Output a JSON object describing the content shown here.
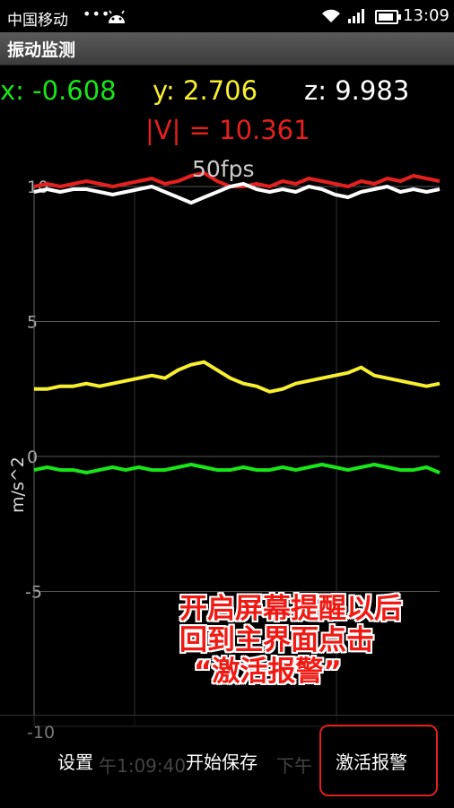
{
  "status_bar": {
    "carrier": "中国移动",
    "dots": "•••",
    "time": "13:09",
    "icons": [
      "android-icon",
      "wifi-icon",
      "signal-icon",
      "battery-icon"
    ]
  },
  "app_title": "振动监测",
  "readouts": {
    "x": "x: -0.608",
    "y": "y: 2.706",
    "z": "z: 9.983",
    "magnitude": "|V| = 10.361",
    "fps": "50fps"
  },
  "colors": {
    "x": "#19e619",
    "y": "#f7ef2f",
    "z": "#ffffff",
    "magnitude": "#e5201f"
  },
  "chart_data": {
    "type": "line",
    "ylabel": "m/s^2",
    "ylim": [
      -10,
      10
    ],
    "y_ticks": [
      "10",
      "5",
      "0",
      "-5",
      "-10"
    ],
    "x_tick_labels": [
      "午1:09:40",
      "下午"
    ],
    "grid": true,
    "series": [
      {
        "name": "|V|",
        "color": "#e5201f",
        "values": [
          10.0,
          10.1,
          10.0,
          10.1,
          10.2,
          10.1,
          10.0,
          10.1,
          10.2,
          10.3,
          10.1,
          10.2,
          10.4,
          10.5,
          10.2,
          10.0,
          10.0,
          10.1,
          10.0,
          10.2,
          10.1,
          10.3,
          10.2,
          10.1,
          10.0,
          10.2,
          10.1,
          10.3,
          10.2,
          10.4,
          10.3,
          10.2
        ]
      },
      {
        "name": "z",
        "color": "#ffffff",
        "values": [
          9.8,
          9.9,
          9.8,
          9.9,
          9.9,
          9.8,
          9.7,
          9.8,
          9.9,
          10.0,
          9.8,
          9.6,
          9.4,
          9.6,
          9.8,
          10.0,
          10.1,
          9.9,
          9.8,
          9.9,
          9.8,
          10.0,
          9.9,
          9.7,
          9.6,
          9.8,
          9.9,
          10.0,
          9.8,
          9.9,
          9.8,
          9.9
        ]
      },
      {
        "name": "y",
        "color": "#f7ef2f",
        "values": [
          2.5,
          2.5,
          2.6,
          2.6,
          2.7,
          2.6,
          2.7,
          2.8,
          2.9,
          3.0,
          2.9,
          3.2,
          3.4,
          3.5,
          3.2,
          2.9,
          2.7,
          2.6,
          2.4,
          2.5,
          2.7,
          2.8,
          2.9,
          3.0,
          3.1,
          3.3,
          3.0,
          2.9,
          2.8,
          2.7,
          2.6,
          2.7
        ]
      },
      {
        "name": "x",
        "color": "#19e619",
        "values": [
          -0.5,
          -0.4,
          -0.5,
          -0.5,
          -0.6,
          -0.5,
          -0.4,
          -0.5,
          -0.4,
          -0.5,
          -0.5,
          -0.4,
          -0.3,
          -0.4,
          -0.5,
          -0.5,
          -0.4,
          -0.5,
          -0.5,
          -0.4,
          -0.5,
          -0.4,
          -0.3,
          -0.4,
          -0.5,
          -0.4,
          -0.3,
          -0.4,
          -0.5,
          -0.5,
          -0.4,
          -0.6
        ]
      }
    ]
  },
  "overlay_note": {
    "line1": "开启屏幕提醒以后",
    "line2": "回到主界面点击",
    "line3": "“激活报警”"
  },
  "bottom_buttons": {
    "settings": "设置",
    "start_save": "开始保存",
    "activate_alarm": "激活报警"
  }
}
